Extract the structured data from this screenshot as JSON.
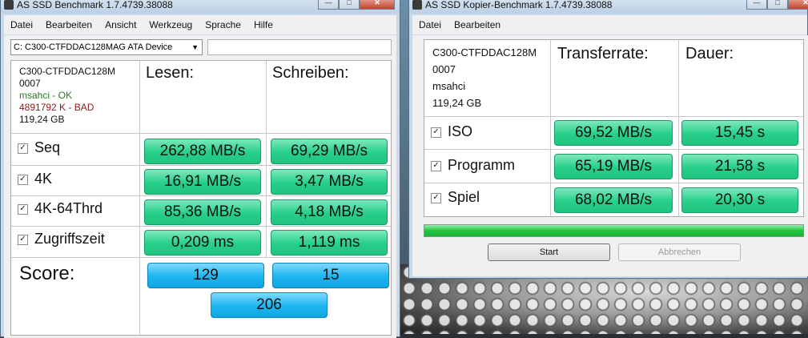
{
  "left_window": {
    "title": "AS SSD Benchmark 1.7.4739.38088",
    "menu": [
      "Datei",
      "Bearbeiten",
      "Ansicht",
      "Werkzeug",
      "Sprache",
      "Hilfe"
    ],
    "drive_select": "C: C300-CTFDDAC128MAG ATA Device",
    "info": {
      "model": "C300-CTFDDAC128M",
      "firmware": "0007",
      "driver": "msahci - OK",
      "alignment": "4891792 K - BAD",
      "size": "119,24 GB"
    },
    "headers": {
      "read": "Lesen:",
      "write": "Schreiben:"
    },
    "rows": [
      {
        "label": "Seq",
        "checked": "✓",
        "read": "262,88 MB/s",
        "write": "69,29 MB/s"
      },
      {
        "label": "4K",
        "checked": "✓",
        "read": "16,91 MB/s",
        "write": "3,47 MB/s"
      },
      {
        "label": "4K-64Thrd",
        "checked": "✓",
        "read": "85,36 MB/s",
        "write": "4,18 MB/s"
      },
      {
        "label": "Zugriffszeit",
        "checked": "✓",
        "read": "0,209 ms",
        "write": "1,119 ms"
      }
    ],
    "score": {
      "label": "Score:",
      "read": "129",
      "write": "15",
      "total": "206"
    },
    "colors": {
      "result_green": "#25cf8a",
      "score_blue": "#1bb5f0",
      "driver_ok": "#2a7a2a",
      "alignment_bad": "#8b1a1a"
    }
  },
  "right_window": {
    "title": "AS SSD Kopier-Benchmark 1.7.4739.38088",
    "menu": [
      "Datei",
      "Bearbeiten"
    ],
    "info": {
      "model": "C300-CTFDDAC128M",
      "firmware": "0007",
      "driver": "msahci",
      "size": "119,24 GB"
    },
    "headers": {
      "rate": "Transferrate:",
      "duration": "Dauer:"
    },
    "rows": [
      {
        "label": "ISO",
        "checked": "✓",
        "rate": "69,52 MB/s",
        "duration": "15,45 s"
      },
      {
        "label": "Programm",
        "checked": "✓",
        "rate": "65,19 MB/s",
        "duration": "21,58 s"
      },
      {
        "label": "Spiel",
        "checked": "✓",
        "rate": "68,02 MB/s",
        "duration": "20,30 s"
      }
    ],
    "progress": 1.0,
    "buttons": {
      "start": "Start",
      "cancel": "Abbrechen"
    }
  },
  "window_controls": {
    "minimize": "—",
    "maximize": "□",
    "close": "✕"
  }
}
